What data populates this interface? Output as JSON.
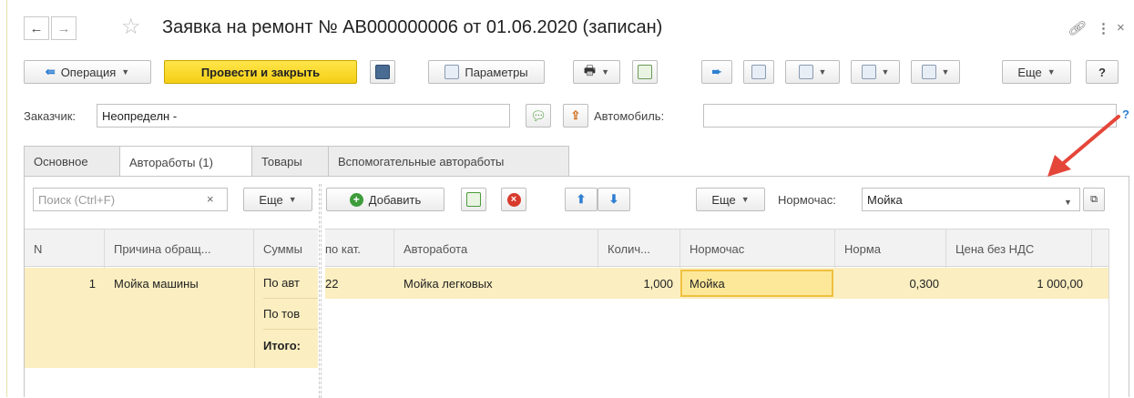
{
  "title": "Заявка на ремонт № АВ000000006 от 01.06.2020 (записан)",
  "toolbar": {
    "operation_label": "Операция",
    "post_close_label": "Провести и закрыть",
    "params_label": "Параметры",
    "more_label": "Еще",
    "help_label": "?"
  },
  "customer": {
    "label": "Заказчик:",
    "value": "Неопределн -"
  },
  "car": {
    "label": "Автомобиль:",
    "value": "",
    "help": "?"
  },
  "tabs": [
    "Основное",
    "Автоработы (1)",
    "Товары",
    "Вспомогательные автоработы"
  ],
  "left_panel": {
    "search_placeholder": "Поиск (Ctrl+F)",
    "clear": "×",
    "more_label": "Еще",
    "columns": [
      "N",
      "Причина обращ...",
      "Суммы"
    ],
    "row": {
      "n": "1",
      "reason": "Мойка машины",
      "sums": [
        "По авт",
        "По тов",
        "Итого:"
      ]
    }
  },
  "right_panel": {
    "add_label": "Добавить",
    "more_label": "Еще",
    "norm_label": "Нормочас:",
    "norm_value": "Мойка",
    "columns": [
      "по кат.",
      "Авторабота",
      "Колич...",
      "Нормочас",
      "Норма",
      "Цена без НДС"
    ],
    "row": {
      "cat": "22",
      "work": "Мойка легковых",
      "qty": "1,000",
      "norm_hour": "Мойка",
      "norm": "0,300",
      "price": "1 000,00"
    }
  },
  "colors": {
    "accent_yellow": "#f5cf15",
    "row_highlight": "#fbeec0",
    "arrow": "#e5463a"
  }
}
